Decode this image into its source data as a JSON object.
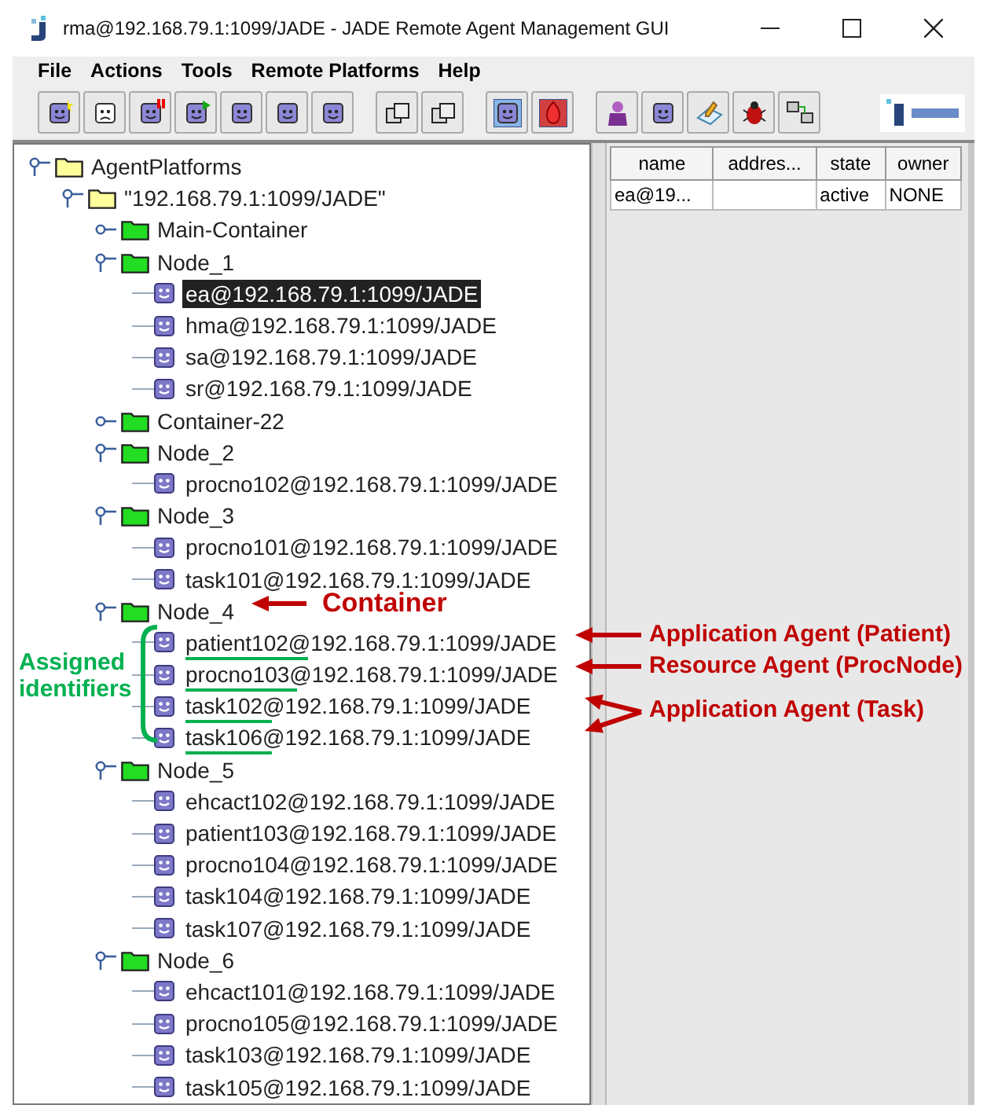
{
  "window": {
    "title": "rma@192.168.79.1:1099/JADE - JADE Remote Agent Management GUI"
  },
  "menu": [
    "File",
    "Actions",
    "Tools",
    "Remote Platforms",
    "Help"
  ],
  "tree": [
    {
      "label": "AgentPlatforms",
      "kind": "root",
      "expanded": true,
      "selected": false,
      "children": [
        {
          "label": "\"192.168.79.1:1099/JADE\"",
          "kind": "platform",
          "expanded": true,
          "selected": false,
          "children": [
            {
              "label": "Main-Container",
              "kind": "container",
              "expanded": false,
              "selected": false
            },
            {
              "label": "Node_1",
              "kind": "container",
              "expanded": true,
              "selected": false,
              "children": [
                {
                  "label": "ea@192.168.79.1:1099/JADE",
                  "kind": "agent",
                  "selected": true,
                  "underlined": false
                },
                {
                  "label": "hma@192.168.79.1:1099/JADE",
                  "kind": "agent",
                  "selected": false,
                  "underlined": false
                },
                {
                  "label": "sa@192.168.79.1:1099/JADE",
                  "kind": "agent",
                  "selected": false,
                  "underlined": false
                },
                {
                  "label": "sr@192.168.79.1:1099/JADE",
                  "kind": "agent",
                  "selected": false,
                  "underlined": false
                }
              ]
            },
            {
              "label": "Container-22",
              "kind": "container",
              "expanded": false,
              "selected": false
            },
            {
              "label": "Node_2",
              "kind": "container",
              "expanded": true,
              "selected": false,
              "children": [
                {
                  "label": "procno102@192.168.79.1:1099/JADE",
                  "kind": "agent",
                  "selected": false,
                  "underlined": false
                }
              ]
            },
            {
              "label": "Node_3",
              "kind": "container",
              "expanded": true,
              "selected": false,
              "children": [
                {
                  "label": "procno101@192.168.79.1:1099/JADE",
                  "kind": "agent",
                  "selected": false,
                  "underlined": false
                },
                {
                  "label": "task101@192.168.79.1:1099/JADE",
                  "kind": "agent",
                  "selected": false,
                  "underlined": false
                }
              ]
            },
            {
              "label": "Node_4",
              "kind": "container",
              "expanded": true,
              "selected": false,
              "children": [
                {
                  "label": "patient102@192.168.79.1:1099/JADE",
                  "kind": "agent",
                  "selected": false,
                  "underlined": true
                },
                {
                  "label": "procno103@192.168.79.1:1099/JADE",
                  "kind": "agent",
                  "selected": false,
                  "underlined": true
                },
                {
                  "label": "task102@192.168.79.1:1099/JADE",
                  "kind": "agent",
                  "selected": false,
                  "underlined": true
                },
                {
                  "label": "task106@192.168.79.1:1099/JADE",
                  "kind": "agent",
                  "selected": false,
                  "underlined": true
                }
              ]
            },
            {
              "label": "Node_5",
              "kind": "container",
              "expanded": true,
              "selected": false,
              "children": [
                {
                  "label": "ehcact102@192.168.79.1:1099/JADE",
                  "kind": "agent",
                  "selected": false,
                  "underlined": false
                },
                {
                  "label": "patient103@192.168.79.1:1099/JADE",
                  "kind": "agent",
                  "selected": false,
                  "underlined": false
                },
                {
                  "label": "procno104@192.168.79.1:1099/JADE",
                  "kind": "agent",
                  "selected": false,
                  "underlined": false
                },
                {
                  "label": "task104@192.168.79.1:1099/JADE",
                  "kind": "agent",
                  "selected": false,
                  "underlined": false
                },
                {
                  "label": "task107@192.168.79.1:1099/JADE",
                  "kind": "agent",
                  "selected": false,
                  "underlined": false
                }
              ]
            },
            {
              "label": "Node_6",
              "kind": "container",
              "expanded": true,
              "selected": false,
              "children": [
                {
                  "label": "ehcact101@192.168.79.1:1099/JADE",
                  "kind": "agent",
                  "selected": false,
                  "underlined": false
                },
                {
                  "label": "procno105@192.168.79.1:1099/JADE",
                  "kind": "agent",
                  "selected": false,
                  "underlined": false
                },
                {
                  "label": "task103@192.168.79.1:1099/JADE",
                  "kind": "agent",
                  "selected": false,
                  "underlined": false
                },
                {
                  "label": "task105@192.168.79.1:1099/JADE",
                  "kind": "agent",
                  "selected": false,
                  "underlined": false
                }
              ]
            }
          ]
        }
      ]
    }
  ],
  "agent_table": {
    "columns": [
      "name",
      "addres...",
      "state",
      "owner"
    ],
    "rows": [
      {
        "cells": [
          "ea@19...",
          null,
          "active",
          "NONE"
        ]
      }
    ]
  },
  "annotations": [
    {
      "text": "Container",
      "color": "#c00000"
    },
    {
      "text": "Application Agent (Patient)",
      "color": "#c00000"
    },
    {
      "text": "Resource Agent (ProcNode)",
      "color": "#c00000"
    },
    {
      "text": "Application Agent (Task)",
      "color": "#c00000"
    },
    {
      "text": "Assigned identifiers",
      "color": "#00b050"
    }
  ]
}
